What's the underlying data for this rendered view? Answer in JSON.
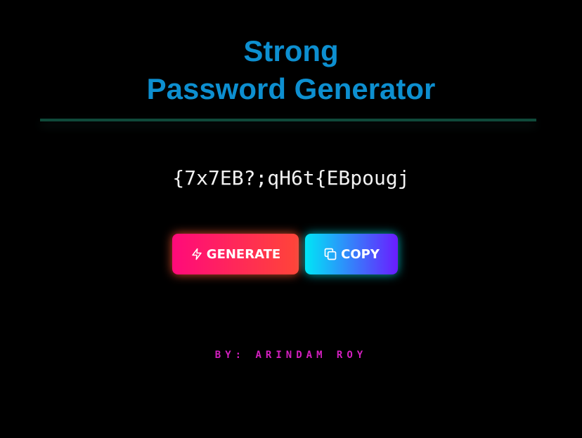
{
  "header": {
    "title_line1": "Strong",
    "title_line2": "Password Generator"
  },
  "password": {
    "value": "{7x7EB?;qH6t{EBpougj"
  },
  "actions": {
    "generate_label": "GENERATE",
    "generate_icon": "lightning-bolt-icon",
    "copy_label": "COPY",
    "copy_icon": "copy-icon"
  },
  "footer": {
    "credit": "BY: ARINDAM ROY"
  },
  "colors": {
    "background": "#000000",
    "title": "#0d8fd0",
    "divider": "#0f4a3a",
    "password_text": "#f2f2f2",
    "generate_gradient": [
      "#ff0a7a",
      "#ff4538"
    ],
    "copy_gradient": [
      "#00e6f6",
      "#6a1cff"
    ],
    "footer_text": "#d41fc0"
  }
}
